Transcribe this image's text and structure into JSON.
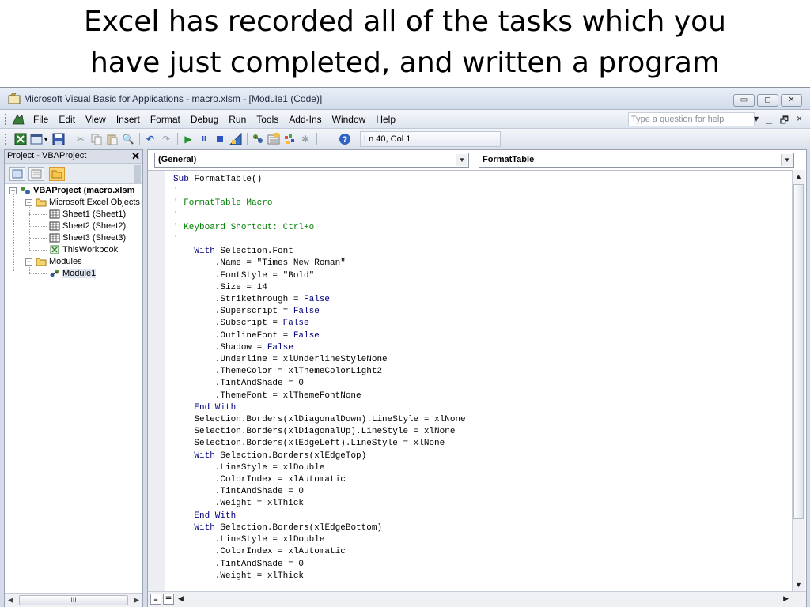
{
  "slide": {
    "title_line1": "Excel has recorded all of the tasks which you",
    "title_line2": "have just completed, and written a program"
  },
  "window": {
    "title": "Microsoft Visual Basic for Applications - macro.xlsm - [Module1 (Code)]",
    "controls": [
      "▭",
      "◻",
      "✕"
    ]
  },
  "menu": {
    "items": [
      "File",
      "Edit",
      "View",
      "Insert",
      "Format",
      "Debug",
      "Run",
      "Tools",
      "Add-Ins",
      "Window",
      "Help"
    ],
    "help_placeholder": "Type a question for help",
    "mdi_controls": [
      "▾",
      "_",
      "🗗",
      "×"
    ]
  },
  "toolbar": {
    "cursor_position": "Ln 40, Col 1"
  },
  "project_pane": {
    "title": "Project - VBAProject",
    "close_label": "✕",
    "tree": {
      "root": "VBAProject (macro.xlsm",
      "excel_objects": "Microsoft Excel Objects",
      "sheets": [
        "Sheet1 (Sheet1)",
        "Sheet2 (Sheet2)",
        "Sheet3 (Sheet3)",
        "ThisWorkbook"
      ],
      "modules": "Modules",
      "module1": "Module1"
    },
    "scroll_thumb": "III"
  },
  "code_window": {
    "object_dropdown": "(General)",
    "procedure_dropdown": "FormatTable",
    "code": [
      [
        {
          "t": "Sub ",
          "c": "kw"
        },
        {
          "t": "FormatTable()"
        }
      ],
      [
        {
          "t": "'",
          "c": "cm"
        }
      ],
      [
        {
          "t": "' FormatTable Macro",
          "c": "cm"
        }
      ],
      [
        {
          "t": "'",
          "c": "cm"
        }
      ],
      [
        {
          "t": "' Keyboard Shortcut: Ctrl+o",
          "c": "cm"
        }
      ],
      [
        {
          "t": "'",
          "c": "cm"
        }
      ],
      [
        {
          "t": "    "
        },
        {
          "t": "With ",
          "c": "kw"
        },
        {
          "t": "Selection.Font"
        }
      ],
      [
        {
          "t": "        .Name = \"Times New Roman\""
        }
      ],
      [
        {
          "t": "        .FontStyle = \"Bold\""
        }
      ],
      [
        {
          "t": "        .Size = 14"
        }
      ],
      [
        {
          "t": "        .Strikethrough = "
        },
        {
          "t": "False",
          "c": "kw"
        }
      ],
      [
        {
          "t": "        .Superscript = "
        },
        {
          "t": "False",
          "c": "kw"
        }
      ],
      [
        {
          "t": "        .Subscript = "
        },
        {
          "t": "False",
          "c": "kw"
        }
      ],
      [
        {
          "t": "        .OutlineFont = "
        },
        {
          "t": "False",
          "c": "kw"
        }
      ],
      [
        {
          "t": "        .Shadow = "
        },
        {
          "t": "False",
          "c": "kw"
        }
      ],
      [
        {
          "t": "        .Underline = xlUnderlineStyleNone"
        }
      ],
      [
        {
          "t": "        .ThemeColor = xlThemeColorLight2"
        }
      ],
      [
        {
          "t": "        .TintAndShade = 0"
        }
      ],
      [
        {
          "t": "        .ThemeFont = xlThemeFontNone"
        }
      ],
      [
        {
          "t": "    "
        },
        {
          "t": "End With",
          "c": "kw"
        }
      ],
      [
        {
          "t": "    Selection.Borders(xlDiagonalDown).LineStyle = xlNone"
        }
      ],
      [
        {
          "t": "    Selection.Borders(xlDiagonalUp).LineStyle = xlNone"
        }
      ],
      [
        {
          "t": "    Selection.Borders(xlEdgeLeft).LineStyle = xlNone"
        }
      ],
      [
        {
          "t": "    "
        },
        {
          "t": "With ",
          "c": "kw"
        },
        {
          "t": "Selection.Borders(xlEdgeTop)"
        }
      ],
      [
        {
          "t": "        .LineStyle = xlDouble"
        }
      ],
      [
        {
          "t": "        .ColorIndex = xlAutomatic"
        }
      ],
      [
        {
          "t": "        .TintAndShade = 0"
        }
      ],
      [
        {
          "t": "        .Weight = xlThick"
        }
      ],
      [
        {
          "t": "    "
        },
        {
          "t": "End With",
          "c": "kw"
        }
      ],
      [
        {
          "t": "    "
        },
        {
          "t": "With ",
          "c": "kw"
        },
        {
          "t": "Selection.Borders(xlEdgeBottom)"
        }
      ],
      [
        {
          "t": "        .LineStyle = xlDouble"
        }
      ],
      [
        {
          "t": "        .ColorIndex = xlAutomatic"
        }
      ],
      [
        {
          "t": "        .TintAndShade = 0"
        }
      ],
      [
        {
          "t": "        .Weight = xlThick"
        }
      ]
    ]
  },
  "colors": {
    "keyword": "#00007f",
    "comment": "#007f00",
    "chrome": "#d6dbe9"
  }
}
